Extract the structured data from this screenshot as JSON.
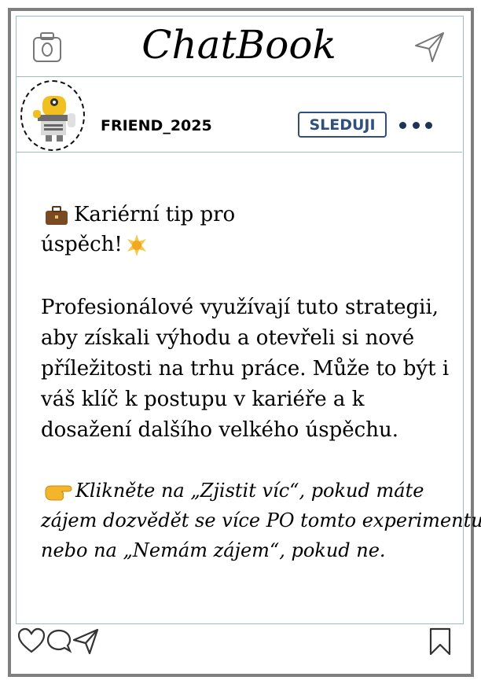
{
  "app": {
    "title": "ChatBook"
  },
  "icons": {
    "camera": "camera-icon",
    "send": "send-icon",
    "like": "heart-icon",
    "comment": "comment-icon",
    "share": "share-icon",
    "bookmark": "bookmark-icon",
    "more": "more-icon",
    "briefcase": "briefcase-icon",
    "sparkle": "sparkle-icon",
    "pointing": "pointing-right-icon"
  },
  "profile": {
    "username": "FRIEND_2025",
    "follow_label": "SLEDUJI"
  },
  "post": {
    "headline_line1": "Kariérní tip pro",
    "headline_line2": "úspěch!",
    "body_lines": [
      "Profesionálové využívají tuto strategii,",
      "aby získali výhodu a otevřeli si nové",
      "příležitosti na trhu práce. Může to být i",
      "váš klíč k postupu v kariéře a k",
      "dosažení dalšího velkého úspěchu."
    ],
    "cta_lines": [
      "Klikněte na „Zjistit víc“, pokud máte",
      "zájem dozvědět se více PO tomto experimentu,",
      "nebo na „Nemám zájem“, pokud ne."
    ]
  },
  "colors": {
    "frame": "#7f7f7f",
    "divider": "#9fb9cc",
    "accent": "#2f4f7f",
    "dots": "#1e3557"
  }
}
